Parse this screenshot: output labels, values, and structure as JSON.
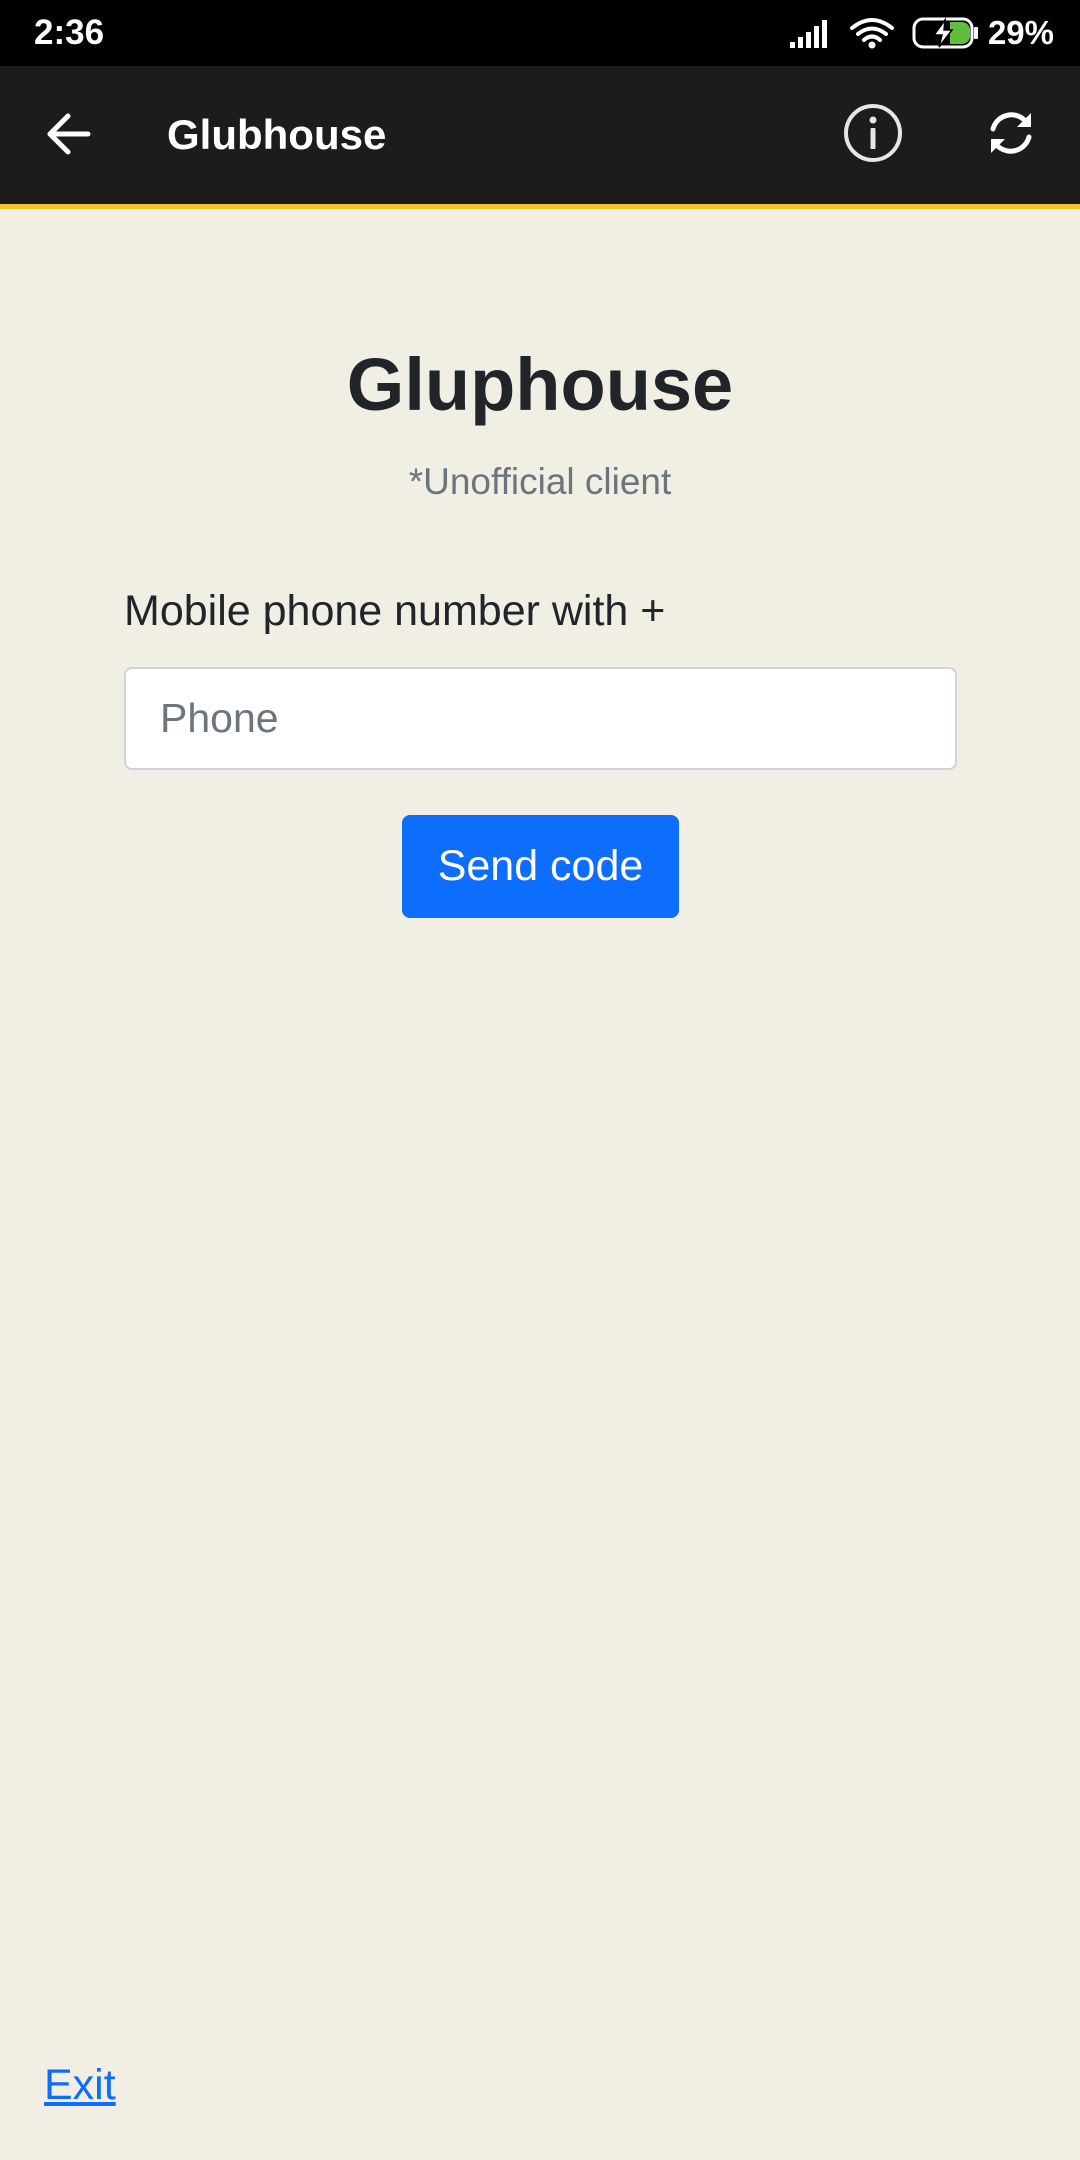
{
  "status_bar": {
    "time": "2:36",
    "battery_percent": "29%",
    "icons": [
      "signal-icon",
      "wifi-icon",
      "battery-charging-icon"
    ]
  },
  "app_bar": {
    "title": "Glubhouse",
    "back_icon": "arrow-left-icon",
    "info_icon": "info-icon",
    "refresh_icon": "refresh-icon",
    "accent_color": "#f6c12b",
    "background_color": "#1c1c1c"
  },
  "login": {
    "heading": "Gluphouse",
    "subtitle": "*Unofficial client",
    "phone_label": "Mobile phone number with +",
    "phone_placeholder": "Phone",
    "phone_value": "",
    "send_button_label": "Send code",
    "button_color": "#0d6efd"
  },
  "footer": {
    "exit_label": "Exit"
  }
}
